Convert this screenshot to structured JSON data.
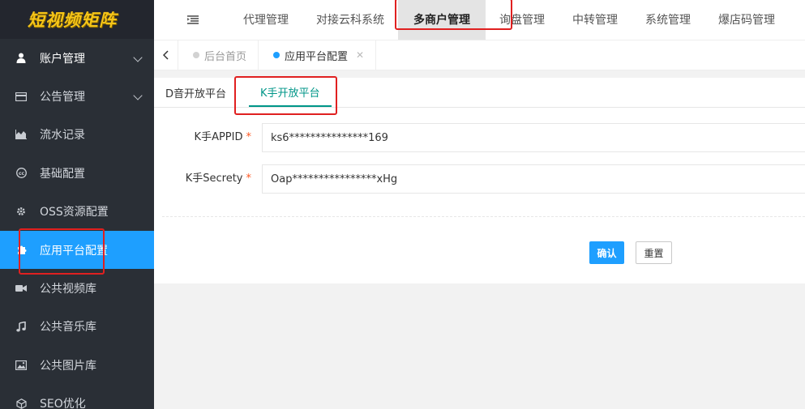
{
  "app": {
    "logo_text": "短视频矩阵"
  },
  "sidebar": {
    "items": [
      {
        "label": "账户管理",
        "icon": "user-icon",
        "has_submenu": true
      },
      {
        "label": "公告管理",
        "icon": "card-icon",
        "has_submenu": true
      },
      {
        "label": "流水记录",
        "icon": "area-chart-icon",
        "has_submenu": false
      },
      {
        "label": "基础配置",
        "icon": "cc-icon",
        "has_submenu": false
      },
      {
        "label": "OSS资源配置",
        "icon": "gear-icon",
        "has_submenu": false
      },
      {
        "label": "应用平台配置",
        "icon": "puzzle-icon",
        "has_submenu": false,
        "active": true
      },
      {
        "label": "公共视频库",
        "icon": "video-icon",
        "has_submenu": false
      },
      {
        "label": "公共音乐库",
        "icon": "music-icon",
        "has_submenu": false
      },
      {
        "label": "公共图片库",
        "icon": "image-icon",
        "has_submenu": false
      },
      {
        "label": "SEO优化",
        "icon": "cube-icon",
        "has_submenu": false
      }
    ]
  },
  "topnav": {
    "items": [
      {
        "label": "代理管理"
      },
      {
        "label": "对接云科系统"
      },
      {
        "label": "多商户管理",
        "active": true
      },
      {
        "label": "询盘管理"
      },
      {
        "label": "中转管理"
      },
      {
        "label": "系统管理"
      },
      {
        "label": "爆店码管理"
      }
    ]
  },
  "tabs": {
    "items": [
      {
        "label": "后台首页",
        "dot_color": "#d2d2d2",
        "closable": false
      },
      {
        "label": "应用平台配置",
        "dot_color": "#1e9fff",
        "closable": true
      }
    ]
  },
  "subtabs": {
    "items": [
      {
        "label": "D音开放平台",
        "active": false
      },
      {
        "label": "K手开放平台",
        "active": true
      }
    ]
  },
  "form": {
    "appid": {
      "label": "K手APPID",
      "required_mark": "*",
      "value": "ks6***************169"
    },
    "secret": {
      "label": "K手Secrety",
      "required_mark": "*",
      "value": "Oap****************xHg"
    },
    "submit_label": "确认",
    "reset_label": "重置"
  },
  "colors": {
    "accent": "#1e9fff",
    "tab_active": "#009688",
    "sidebar_bg": "#2a2f36",
    "highlight": "#e02020"
  }
}
